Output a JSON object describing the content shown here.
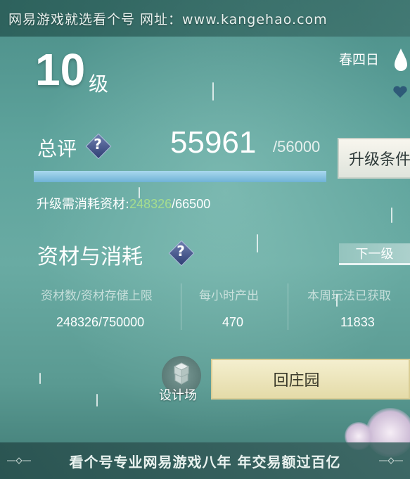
{
  "watermark_top": "网易游戏就选看个号  网址：www.kangehao.com",
  "watermark_bottom": "看个号专业网易游戏八年  年交易额过百亿",
  "level": {
    "value": "10",
    "unit": "级"
  },
  "season": "春四日",
  "score": {
    "label": "总评",
    "help": "?",
    "value": "55961",
    "max": "/56000",
    "progress": 0.9993
  },
  "upgrade_button": "升级条件",
  "consume": {
    "label": "升级需消耗资材:",
    "current": "248326",
    "total": "/66500"
  },
  "section": {
    "title": "资材与消耗",
    "help": "?",
    "next_level": "下一级"
  },
  "stats": [
    {
      "header": "资材数/资材存储上限",
      "value": "248326/750000"
    },
    {
      "header": "每小时产出",
      "value": "470"
    },
    {
      "header": "本周玩法已获取",
      "value": "11833"
    }
  ],
  "design_label": "设计场",
  "home_button": "回庄园",
  "colors": {
    "accent_green": "#a6dd8e",
    "progress": "#8cc8e4"
  }
}
